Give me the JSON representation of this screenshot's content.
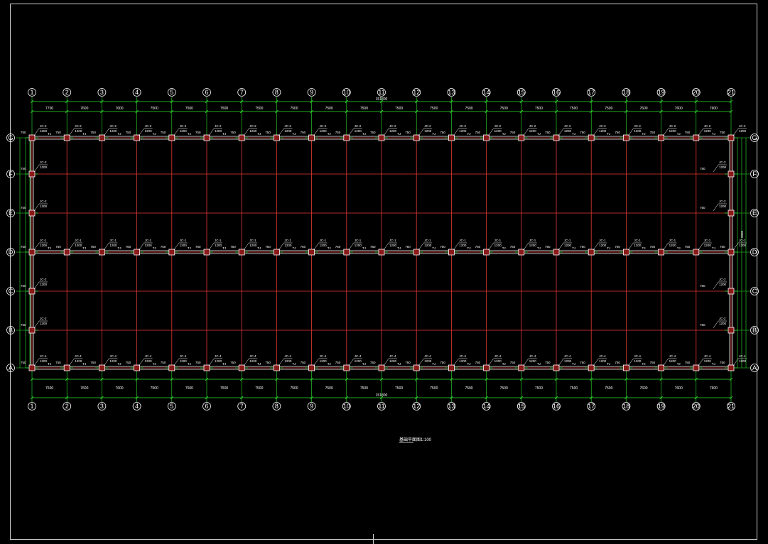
{
  "drawing": {
    "columns": [
      "1",
      "2",
      "3",
      "4",
      "5",
      "6",
      "7",
      "8",
      "9",
      "10",
      "11",
      "12",
      "13",
      "14",
      "15",
      "16",
      "17",
      "18",
      "19",
      "20",
      "21"
    ],
    "rows": [
      "A",
      "B",
      "C",
      "D",
      "E",
      "F",
      "G"
    ],
    "spans_top": [
      "7700",
      "7600",
      "7600",
      "7500",
      "7500",
      "7500",
      "7500",
      "7500",
      "7500",
      "7500",
      "7500",
      "7500",
      "7500",
      "7500",
      "7500",
      "7500",
      "7500",
      "7600",
      "7600",
      "7600"
    ],
    "spans_bottom": [
      "7600",
      "7600",
      "7600",
      "7500",
      "7500",
      "7500",
      "7500",
      "7500",
      "7500",
      "7500",
      "7500",
      "7500",
      "7500",
      "7500",
      "7500",
      "7500",
      "7500",
      "7600",
      "7600",
      "7600"
    ],
    "total_length": "151800",
    "column_offset_label": "750",
    "foundation_tag": "TJ",
    "callouts": {
      "row_g": "JC-2",
      "row_d": "JC-1",
      "row_a": "JC-4",
      "end_walls": "JC-2"
    },
    "depth_label": "1200",
    "side_dim": "9000",
    "caption": "基础平面图",
    "scale": "1:100",
    "colors": {
      "background": "#000000",
      "grid": "#e53935",
      "dimension": "#2ee62e",
      "wall": "#ffffff",
      "text": "#ffffff",
      "column_fill": "#8b1a1a",
      "frame": "#cfcfcf"
    }
  }
}
